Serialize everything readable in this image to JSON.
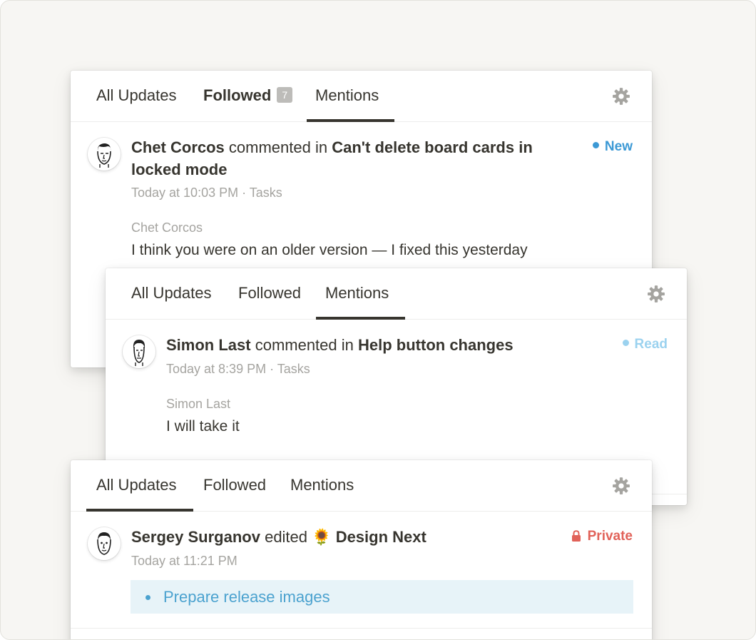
{
  "colors": {
    "new": "#3c99d5",
    "read": "#9bd2ef",
    "private": "#e16259",
    "bullet_bg": "#e7f3f8",
    "bullet_text": "#4ba2cf"
  },
  "panel_followed": {
    "tabs": [
      "All Updates",
      "Followed",
      "Mentions"
    ],
    "followed_count": "7",
    "gear_icon": "gear-icon",
    "item": {
      "actor": "Chet Corcos",
      "verb": "commented in",
      "target_line1": "Can't delete board cards in",
      "target_line2": "locked mode",
      "status": "New",
      "time": "Today at 10:03 PM",
      "separator": "·",
      "location": "Tasks",
      "comment_author": "Chet Corcos",
      "comment_text": "I think you were on an older version — I fixed this yesterday"
    }
  },
  "panel_mentions": {
    "tabs": [
      "All Updates",
      "Followed",
      "Mentions"
    ],
    "gear_icon": "gear-icon",
    "item": {
      "actor": "Simon Last",
      "verb": "commented in",
      "target": "Help button changes",
      "status": "Read",
      "time": "Today at 8:39 PM",
      "separator": "·",
      "location": "Tasks",
      "comment_author": "Simon Last",
      "comment_text": "I will take it"
    }
  },
  "panel_all": {
    "tabs": [
      "All Updates",
      "Followed",
      "Mentions"
    ],
    "gear_icon": "gear-icon",
    "item": {
      "actor": "Sergey Surganov",
      "verb": "edited",
      "emoji": "🌻",
      "target": "Design Next",
      "status": "Private",
      "time": "Today at 11:21 PM",
      "bullet": "Prepare release images"
    }
  }
}
